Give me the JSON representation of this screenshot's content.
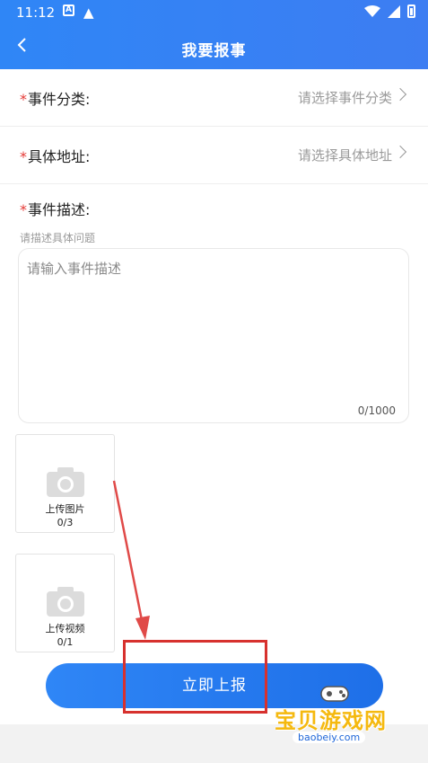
{
  "status_bar": {
    "time": "11:12",
    "notification_icons": [
      "a-icon",
      "warning-icon"
    ],
    "system_icons": [
      "wifi-icon",
      "signal-icon",
      "battery-icon"
    ]
  },
  "header": {
    "title": "我要报事",
    "back_icon": "chevron-left-icon"
  },
  "form": {
    "category": {
      "label": "事件分类:",
      "value": "请选择事件分类"
    },
    "address": {
      "label": "具体地址:",
      "value": "请选择具体地址"
    },
    "description": {
      "label": "事件描述:",
      "hint": "请描述具体问题",
      "placeholder": "请输入事件描述",
      "counter": "0/1000"
    },
    "required_mark": "*"
  },
  "uploads": {
    "image": {
      "label": "上传图片",
      "count": "0/3",
      "icon": "camera-icon"
    },
    "video": {
      "label": "上传视频",
      "count": "0/1",
      "icon": "camera-icon"
    }
  },
  "submit": {
    "label": "立即上报"
  },
  "watermark": {
    "title": "宝贝游戏网",
    "url": "baobeiy.com"
  },
  "colors": {
    "primary": "#2f86f6",
    "required": "#e53935",
    "annotation": "#d7312e"
  }
}
